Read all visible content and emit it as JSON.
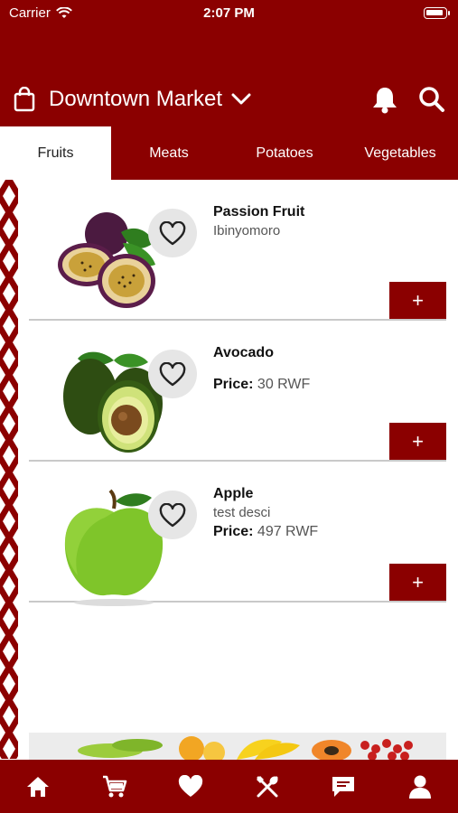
{
  "status_bar": {
    "carrier": "Carrier",
    "time": "2:07 PM"
  },
  "header": {
    "store_name": "Downtown Market"
  },
  "tabs": [
    {
      "label": "Fruits",
      "active": true
    },
    {
      "label": "Meats",
      "active": false
    },
    {
      "label": "Potatoes",
      "active": false
    },
    {
      "label": "Vegetables",
      "active": false
    }
  ],
  "products": [
    {
      "name": "Passion Fruit",
      "subtitle": "Ibinyomoro",
      "price_label": "",
      "price_value": "",
      "image": "passion-fruit"
    },
    {
      "name": "Avocado",
      "subtitle": "",
      "price_label": "Price:",
      "price_value": " 30 RWF",
      "image": "avocado"
    },
    {
      "name": "Apple",
      "subtitle": "test desci",
      "price_label": "Price:",
      "price_value": " 497 RWF",
      "image": "apple"
    }
  ],
  "add_label": "+",
  "bottom_nav": [
    "home-icon",
    "cart-icon",
    "heart-icon",
    "utensils-icon",
    "chat-icon",
    "profile-icon"
  ],
  "colors": {
    "brand": "#8b0000",
    "divider": "#c9c9c9"
  }
}
